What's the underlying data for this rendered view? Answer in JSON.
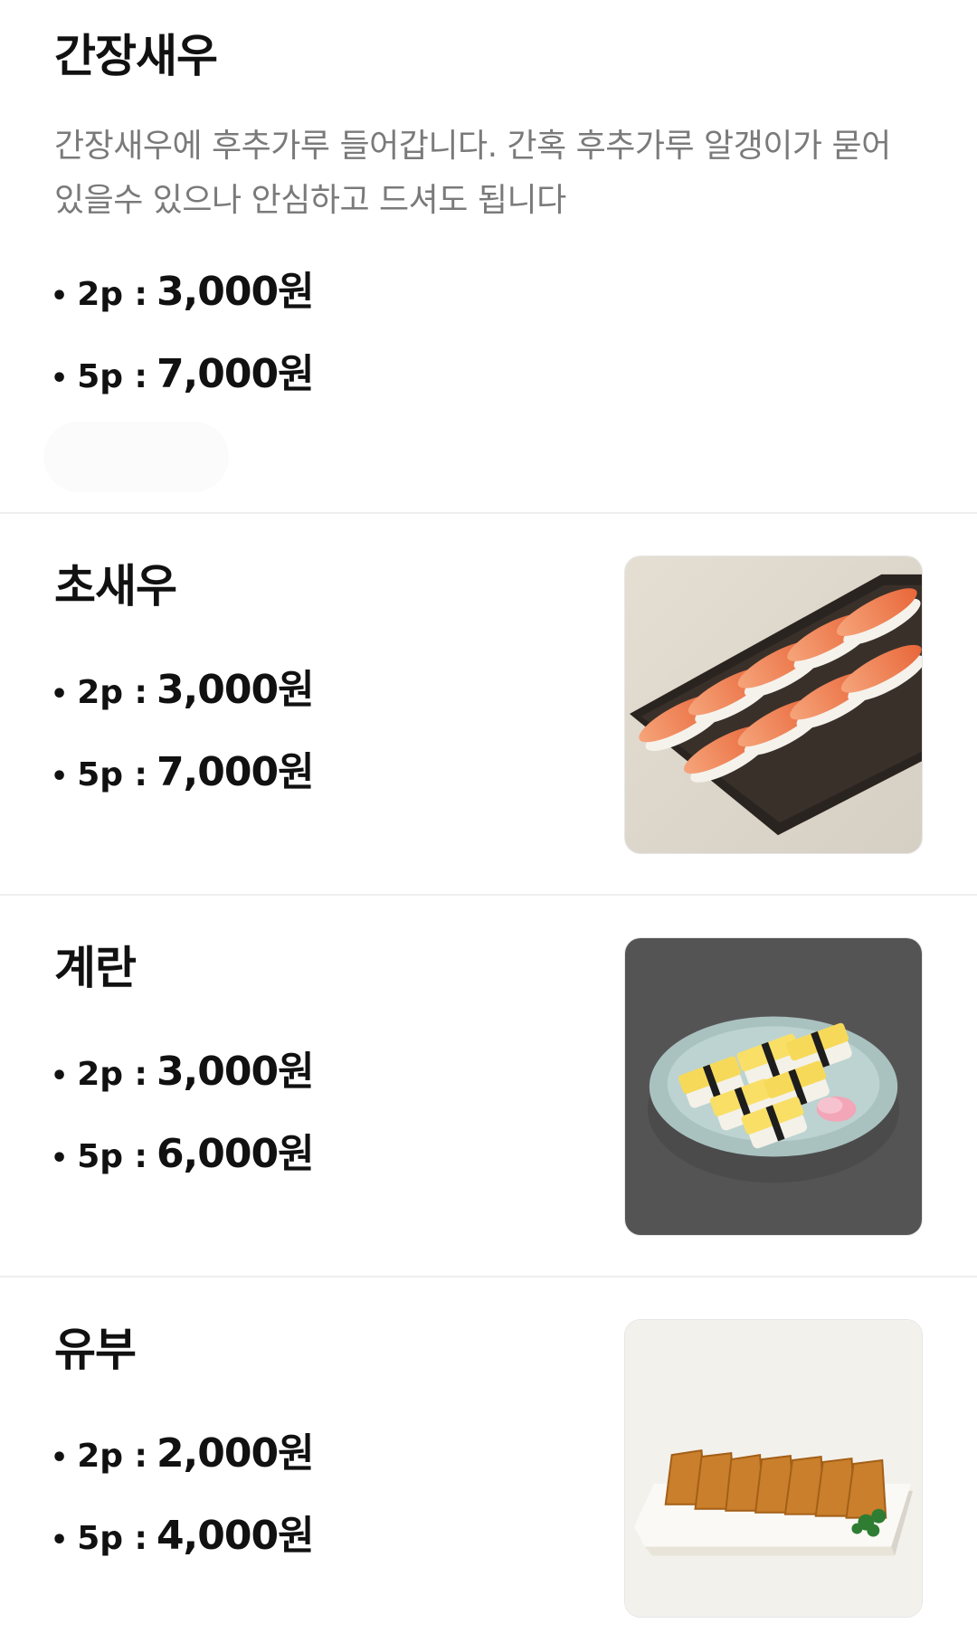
{
  "items": [
    {
      "name": "간장새우",
      "description": "간장새우에 후추가루 들어갑니다. 간혹 후추가루 알갱이가 묻어있을수 있으나 안심하고 드셔도 됩니다",
      "prices": [
        {
          "label": "2p :",
          "value": "3,000원"
        },
        {
          "label": "5p :",
          "value": "7,000원"
        }
      ]
    },
    {
      "name": "초새우",
      "image": "shrimp-sushi-photo",
      "prices": [
        {
          "label": "2p :",
          "value": "3,000원"
        },
        {
          "label": "5p :",
          "value": "7,000원"
        }
      ]
    },
    {
      "name": "계란",
      "image": "egg-sushi-photo",
      "prices": [
        {
          "label": "2p :",
          "value": "3,000원"
        },
        {
          "label": "5p :",
          "value": "6,000원"
        }
      ]
    },
    {
      "name": "유부",
      "image": "inari-sushi-photo",
      "prices": [
        {
          "label": "2p :",
          "value": "2,000원"
        },
        {
          "label": "5p :",
          "value": "4,000원"
        }
      ]
    }
  ],
  "bullet": "•"
}
